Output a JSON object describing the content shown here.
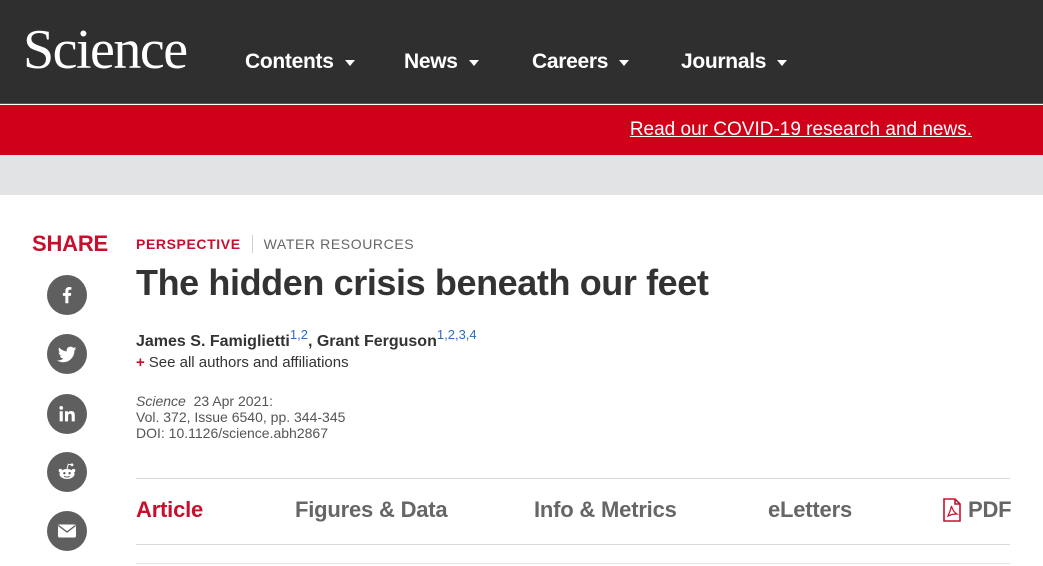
{
  "header": {
    "logo_text": "Science",
    "nav": [
      {
        "label": "Contents"
      },
      {
        "label": "News"
      },
      {
        "label": "Careers"
      },
      {
        "label": "Journals"
      }
    ]
  },
  "alert": {
    "link_text": "Read our COVID-19 research and news."
  },
  "share": {
    "label": "SHARE",
    "buttons": [
      "facebook-icon",
      "twitter-icon",
      "linkedin-icon",
      "reddit-icon",
      "email-icon"
    ]
  },
  "article": {
    "type": "PERSPECTIVE",
    "subject": "WATER RESOURCES",
    "title": "The hidden crisis beneath our feet",
    "authors": [
      {
        "name": "James S. Famiglietti",
        "affiliations": [
          "1",
          "2"
        ]
      },
      {
        "name": "Grant Ferguson",
        "affiliations": [
          "1",
          "2",
          "3",
          "4"
        ]
      }
    ],
    "author_separator": ", ",
    "see_all": "See all authors and affiliations",
    "citation": {
      "journal": "Science",
      "date": "23 Apr 2021:",
      "volume_line": "Vol. 372, Issue 6540, pp. 344-345",
      "doi_line": "DOI: 10.1126/science.abh2867"
    }
  },
  "tabs": [
    {
      "label": "Article",
      "active": true
    },
    {
      "label": "Figures & Data",
      "active": false
    },
    {
      "label": "Info & Metrics",
      "active": false
    },
    {
      "label": "eLetters",
      "active": false
    },
    {
      "label": "PDF",
      "active": false
    }
  ],
  "colors": {
    "brand_red": "#cf0018",
    "nav_bg": "#2f2f2f",
    "share_icon_bg": "#5f5f5f"
  }
}
